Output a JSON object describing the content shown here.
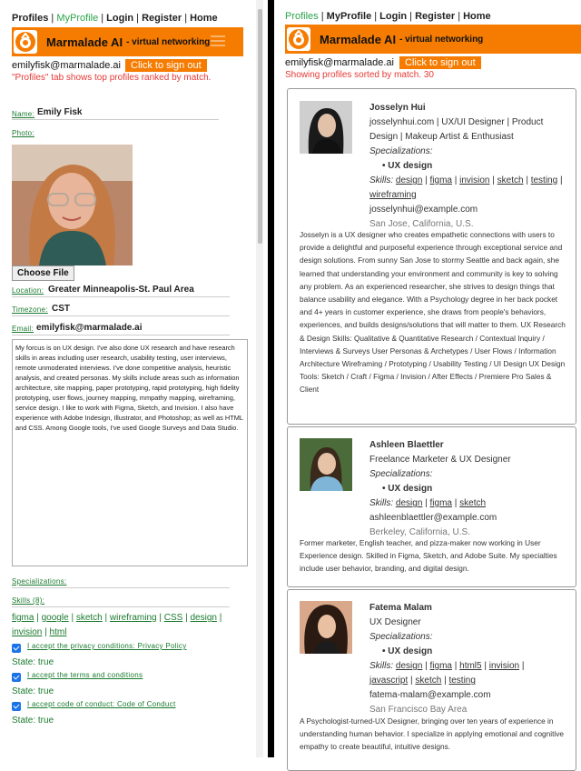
{
  "left": {
    "nav": {
      "profiles": "Profiles",
      "myprofile": "MyProfile",
      "login": "Login",
      "register": "Register",
      "home": "Home"
    },
    "banner": {
      "title": "Marmalade AI",
      "subtitle": "- virtual networking"
    },
    "email": "emilyfisk@marmalade.ai",
    "signout": "Click to sign out",
    "info": "\"Profiles\" tab shows top profiles ranked by match.",
    "name_label": "Name:",
    "name_value": "Emily Fisk",
    "photo_label": "Photo:",
    "choose_file": "Choose File",
    "location_label": "Location:",
    "location_value": "Greater Minneapolis-St. Paul Area",
    "timezone_label": "Timezone:",
    "timezone_value": "CST",
    "email_label": "Email:",
    "email_value": "emilyfisk@marmalade.ai",
    "bio": "My forcus is on UX design. I've also done UX research and have research skills in areas including user research, usability testing, user interviews, remote unmoderated interviews. I've done competitive analysis, heuristic analysis, and created personas.  My skills include areas such as information architecture, site mapping, paper prototyping, rapid prototyping, high fidelity prototyping, user flows, journey mapping, mmpathy mapping, wireframing, service design. I like to work with Figma, Sketch, and Invision. I also have experience with Adobe Indesign, Illustrator, and Photoshop; as well as HTML and CSS. Among Google tools, I've used Google Surveys and Data Studio.",
    "specializations_label": "Specializations:",
    "skills_label": "Skills (8):",
    "skills": [
      "figma",
      "google",
      "sketch",
      "wireframing",
      "CSS",
      "design",
      "invision",
      "html"
    ],
    "privacy_label": "I accept the privacy conditions: Privacy Policy",
    "terms_label": "I accept the terms and conditions",
    "conduct_label": "I accept code of conduct: Code of Conduct",
    "state_true": "State: true"
  },
  "right": {
    "nav": {
      "profiles": "Profiles",
      "myprofile": "MyProfile",
      "login": "Login",
      "register": "Register",
      "home": "Home"
    },
    "banner": {
      "title": "Marmalade AI",
      "subtitle": "- virtual networking"
    },
    "email": "emilyfisk@marmalade.ai",
    "signout": "Click to sign out",
    "info": "Showing profiles sorted by match. 30",
    "spec_heading": "Specializations:",
    "skills_prefix": "Skills:",
    "profiles": [
      {
        "name": "Josselyn Hui",
        "title": "josselynhui.com | UX/UI Designer | Product Design | Makeup Artist & Enthusiast",
        "specialization": "UX design",
        "skills": [
          "design",
          "figma",
          "invision",
          "sketch",
          "testing",
          "wireframing"
        ],
        "email": "josselynhui@example.com",
        "location": "San Jose, California, U.S.",
        "description": "Josselyn is a UX designer who creates empathetic connections with users to provide a delightful and purposeful experience through exceptional service and design solutions. From sunny San Jose to stormy Seattle and back again, she learned that understanding your environment and community is key to solving any problem. As an experienced researcher, she strives to design things that balance usability and elegance. With a Psychology degree in her back pocket and 4+ years in customer experience, she draws from people's behaviors, experiences, and builds designs/solutions that will matter to them. UX Research & Design Skills: Qualitative & Quantitative Research / Contextual Inquiry / Interviews & Surveys User Personas & Archetypes / User Flows / Information Architecture Wireframing / Prototyping / Usability Testing / UI Design UX Design Tools: Sketch / Craft / Figma / Invision / After Effects / Premiere Pro Sales & Client"
      },
      {
        "name": "Ashleen Blaettler",
        "title": "Freelance Marketer & UX Designer",
        "specialization": "UX design",
        "skills": [
          "design",
          "figma",
          "sketch"
        ],
        "email": "ashleenblaettler@example.com",
        "location": "Berkeley, California, U.S.",
        "description": "Former marketer, English teacher, and pizza-maker now working in User Experience design. Skilled in Figma, Sketch, and Adobe Suite. My specialties include user behavior, branding, and digital design."
      },
      {
        "name": "Fatema Malam",
        "title": "UX Designer",
        "specialization": "UX design",
        "skills": [
          "design",
          "figma",
          "html5",
          "invision",
          "javascript",
          "sketch",
          "testing"
        ],
        "email": "fatema-malam@example.com",
        "location": "San Francisco Bay Area",
        "description": "A Psychologist-turned-UX Designer, bringing over ten years of experience in understanding human behavior. I specialize in applying emotional and cognitive empathy to create beautiful, intuitive designs."
      }
    ]
  },
  "colors": {
    "accent": "#f57c00",
    "green": "#1a7a2e",
    "red": "#e53935",
    "checkbox": "#1a73e8"
  }
}
